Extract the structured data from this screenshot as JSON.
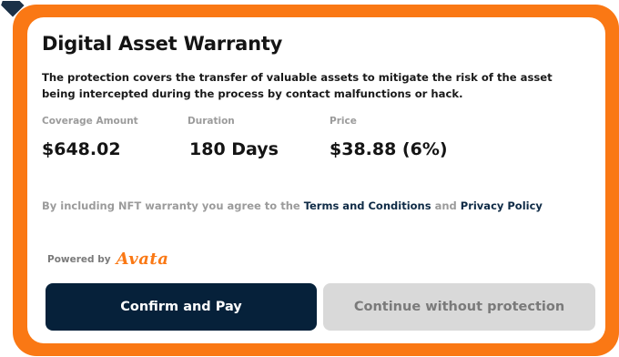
{
  "colors": {
    "accent": "#fa7814",
    "primary_button": "#06213a",
    "secondary_button": "#d9d9d9",
    "link": "#0f2b46"
  },
  "icons": {
    "corner": "diamond-icon"
  },
  "warranty": {
    "title": "Digital Asset Warranty",
    "description": "The protection covers the transfer of valuable assets to mitigate the risk of the asset being intercepted during the process by contact malfunctions or hack.",
    "stats": {
      "coverage": {
        "label": "Coverage Amount",
        "value": "$648.02"
      },
      "duration": {
        "label": "Duration",
        "value": "180 Days"
      },
      "price": {
        "label": "Price",
        "value": "$38.88 (6%)"
      }
    },
    "terms": {
      "prefix": "By including NFT warranty you agree to the ",
      "terms_link": "Terms and Conditions",
      "conjunction": " and ",
      "privacy_link": "Privacy Policy"
    },
    "powered_by": {
      "label": "Powered by",
      "brand": "Avata"
    },
    "actions": {
      "confirm_label": "Confirm and Pay",
      "skip_label": "Continue without protection"
    }
  }
}
